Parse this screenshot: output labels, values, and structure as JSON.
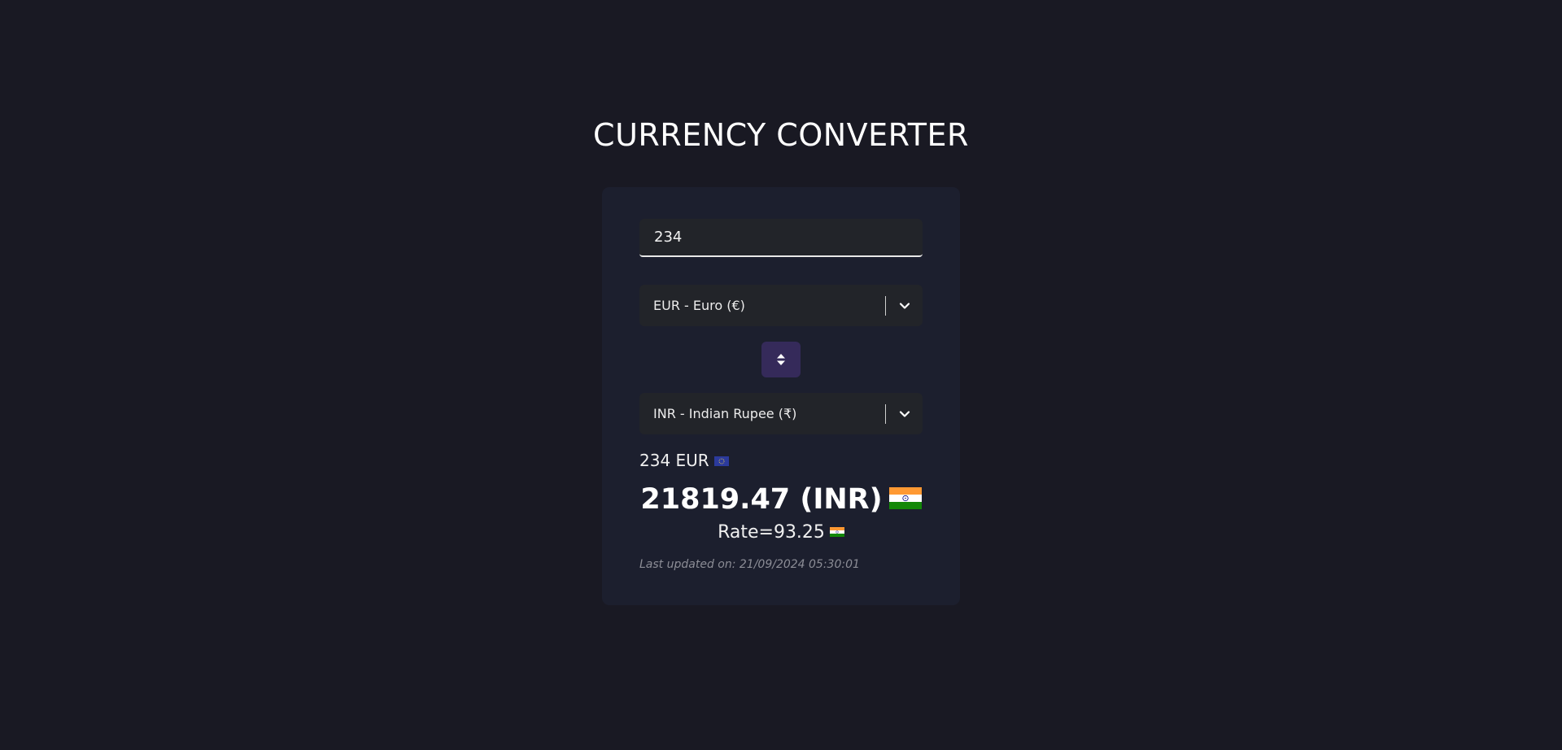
{
  "app": {
    "title": "CURRENCY CONVERTER"
  },
  "amount": {
    "value": "234"
  },
  "from_select": {
    "selected": "EUR - Euro (€)",
    "icon": "chevron-down-icon"
  },
  "swap_button": {
    "icon": "swap-vertical-icon"
  },
  "to_select": {
    "selected": "INR - Indian Rupee (₹)",
    "icon": "chevron-down-icon"
  },
  "result": {
    "source_text": "234 EUR",
    "source_flag": "eu-flag-icon",
    "converted_text": "21819.47 (INR)",
    "converted_flag": "india-flag-icon",
    "rate_text": "Rate=93.25",
    "rate_flag": "india-flag-icon",
    "last_updated": "Last updated on: 21/09/2024 05:30:01"
  },
  "colors": {
    "background": "#191923",
    "card": "#1c1f2e",
    "field": "#222429",
    "swap_button": "#352a5a",
    "muted_text": "#8c8d96"
  }
}
